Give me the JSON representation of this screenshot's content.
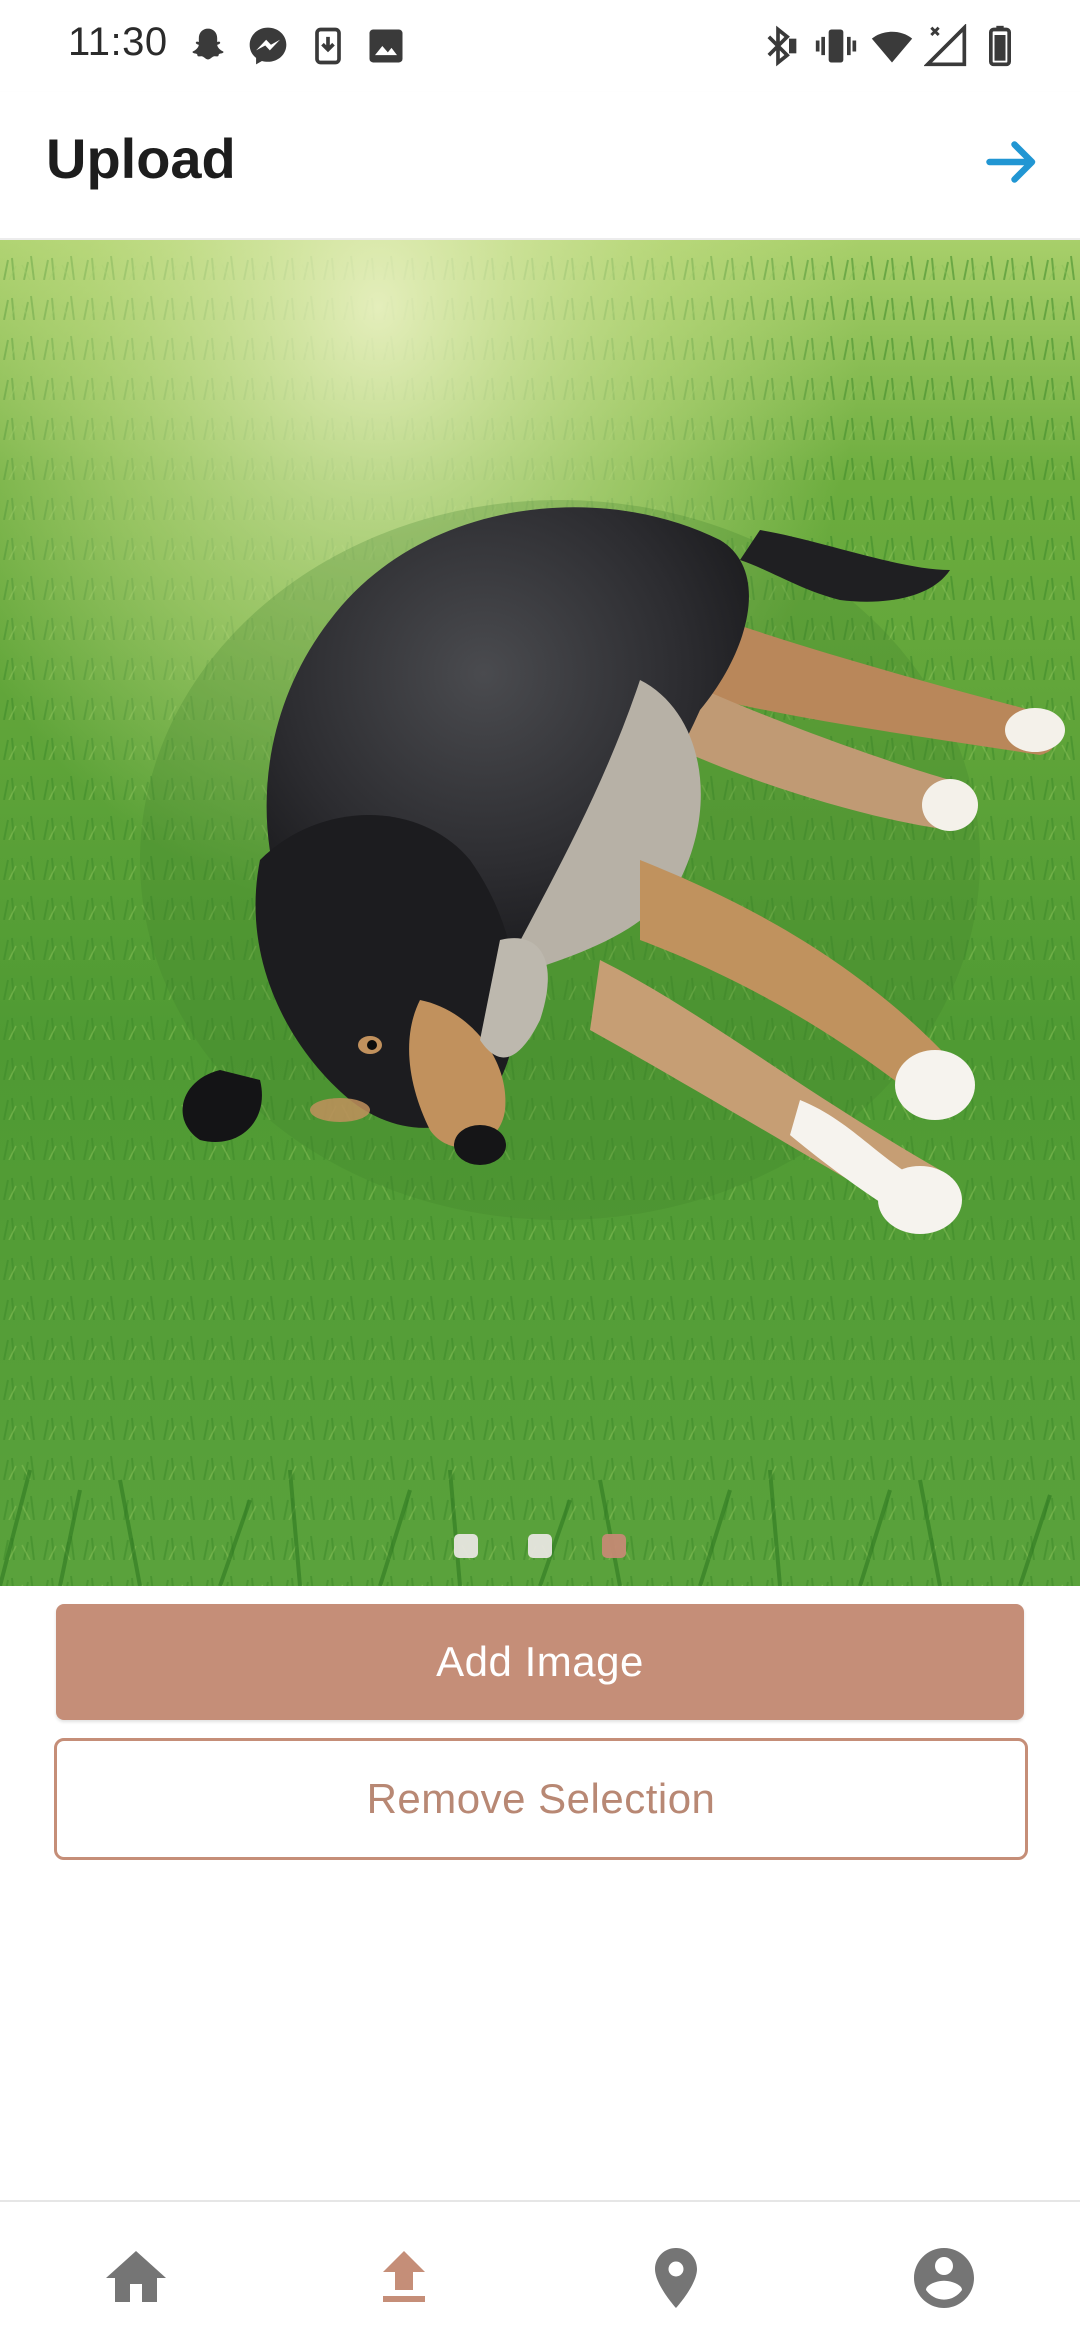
{
  "status_bar": {
    "time": "11:30",
    "left_icons": [
      "snapchat-icon",
      "messenger-icon",
      "download-notification-icon",
      "image-notification-icon"
    ],
    "right_icons": [
      "bluetooth-icon",
      "vibrate-icon",
      "wifi-icon",
      "signal-icon",
      "battery-icon"
    ]
  },
  "app_bar": {
    "title": "Upload",
    "next_icon": "arrow-right-icon",
    "accent_color": "#2196d3"
  },
  "carousel": {
    "image": "dog lying on grass",
    "page_count": 3,
    "active_page": 3,
    "active_dot_color": "#c58a74"
  },
  "actions": {
    "add_image_label": "Add Image",
    "remove_selection_label": "Remove Selection",
    "brand_color": "#c58e78"
  },
  "bottom_nav": {
    "items": [
      {
        "icon": "home-icon",
        "active": false
      },
      {
        "icon": "upload-icon",
        "active": true
      },
      {
        "icon": "location-pin-icon",
        "active": false
      },
      {
        "icon": "account-icon",
        "active": false
      }
    ],
    "active_color": "#c58e78",
    "inactive_color": "#757575"
  }
}
